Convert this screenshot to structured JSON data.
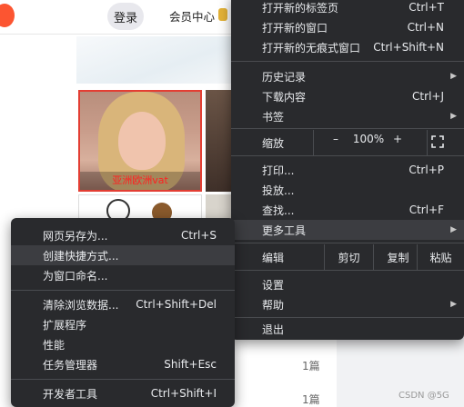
{
  "page": {
    "login_label": "登录",
    "vip_label": "会员中心",
    "thumb_caption": "亚洲欧洲vat",
    "count_1": "1篇",
    "count_2": "1篇",
    "watermark": "CSDN @5G"
  },
  "main_menu": {
    "items_top": [
      {
        "label": "打开新的标签页",
        "shortcut": "Ctrl+T"
      },
      {
        "label": "打开新的窗口",
        "shortcut": "Ctrl+N"
      },
      {
        "label": "打开新的无痕式窗口",
        "shortcut": "Ctrl+Shift+N"
      }
    ],
    "history": {
      "label": "历史记录"
    },
    "downloads": {
      "label": "下载内容",
      "shortcut": "Ctrl+J"
    },
    "bookmarks": {
      "label": "书签"
    },
    "zoom": {
      "label": "缩放",
      "minus": "–",
      "value": "100%",
      "plus": "+",
      "fullscreen_icon": "fullscreen-icon"
    },
    "print": {
      "label": "打印...",
      "shortcut": "Ctrl+P"
    },
    "cast": {
      "label": "投放..."
    },
    "find": {
      "label": "查找...",
      "shortcut": "Ctrl+F"
    },
    "more_tools": {
      "label": "更多工具",
      "highlighted": true
    },
    "edit": {
      "label": "编辑",
      "cut": "剪切",
      "copy": "复制",
      "paste": "粘贴"
    },
    "settings": {
      "label": "设置"
    },
    "help": {
      "label": "帮助"
    },
    "exit": {
      "label": "退出"
    }
  },
  "more_tools_menu": {
    "save_page": {
      "label": "网页另存为...",
      "shortcut": "Ctrl+S"
    },
    "create_shortcut": {
      "label": "创建快捷方式...",
      "highlighted": true
    },
    "name_window": {
      "label": "为窗口命名..."
    },
    "clear_data": {
      "label": "清除浏览数据...",
      "shortcut": "Ctrl+Shift+Del"
    },
    "extensions": {
      "label": "扩展程序"
    },
    "performance": {
      "label": "性能"
    },
    "task_manager": {
      "label": "任务管理器",
      "shortcut": "Shift+Esc"
    },
    "dev_tools": {
      "label": "开发者工具",
      "shortcut": "Ctrl+Shift+I"
    }
  },
  "colors": {
    "menu_bg": "#292a2d",
    "menu_text": "#e8eaed",
    "highlight": "#3c3d41",
    "brand_orange": "#fc5531"
  }
}
